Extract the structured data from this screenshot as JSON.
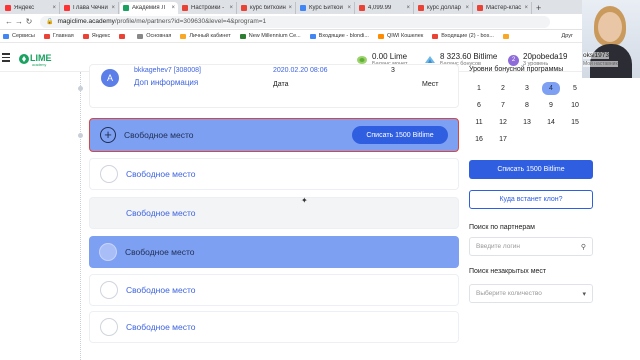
{
  "browser": {
    "tabs": [
      {
        "label": "Яндекс",
        "color": "#f33"
      },
      {
        "label": "Глава Чечни -",
        "color": "#f33"
      },
      {
        "label": "Академия Л",
        "color": "#1aa260",
        "active": true
      },
      {
        "label": "Настройки -",
        "color": "#e94235"
      },
      {
        "label": "курс биткоин",
        "color": "#ea4335"
      },
      {
        "label": "Курс Биткои",
        "color": "#4285f4"
      },
      {
        "label": "4,099.99",
        "color": "#ea4335"
      },
      {
        "label": "курс доллар",
        "color": "#ea4335"
      },
      {
        "label": "Мастер-клас",
        "color": "#ea4335"
      }
    ],
    "new_tab": "+",
    "url_host": "magiclime.academy",
    "url_path": "/profile/me/partners?id=309630&level=4&program=1",
    "nav": {
      "back": "←",
      "forward": "→",
      "reload": "↻"
    }
  },
  "bookmarks": [
    {
      "label": "Сервисы",
      "color": "#4285f4"
    },
    {
      "label": "Главная",
      "color": "#ea4335"
    },
    {
      "label": "Яндекс",
      "color": "#ea4335"
    },
    {
      "label": "",
      "color": "#ea4335"
    },
    {
      "label": "Основная",
      "color": "#888"
    },
    {
      "label": "Личный кабинет",
      "color": "#f9a825"
    },
    {
      "label": "New Millennium Ce...",
      "color": "#2e7d32"
    },
    {
      "label": "Входящие - blondi...",
      "color": "#4285f4"
    },
    {
      "label": "QIWI Кошелек",
      "color": "#ff8c00"
    },
    {
      "label": "Входящие (2) - bos...",
      "color": "#ea4335"
    },
    {
      "label": "",
      "color": "#f9a825"
    }
  ],
  "bookmarks_other": "Друг",
  "header": {
    "logo_text": "LIME",
    "logo_sub": "academy",
    "lime_value": "0.00 Lime",
    "lime_label": "Баланс монет",
    "bitlime_value": "8 323.60 Bitlime",
    "bitlime_label": "Баланс бонусов",
    "user_name": "20pobeda19",
    "user_level": "3 уровень",
    "user_avatar": "2"
  },
  "top_card": {
    "avatar_letter": "A",
    "name_cut": "bkkagehev7 [308008]",
    "date_cut": "2020.02.20 08:06",
    "num_cut": "3",
    "more_link": "Доп информация",
    "date_label": "Дата",
    "places_label": "Мест"
  },
  "slots": [
    {
      "title": "Свободное место",
      "button": "Списать 1500 Bitlime"
    },
    {
      "title": "Свободное место"
    },
    {
      "title": "Свободное место"
    },
    {
      "title": "Свободное место"
    },
    {
      "title": "Свободное место"
    },
    {
      "title": "Свободное место"
    }
  ],
  "right_panel": {
    "levels_title": "Уровни бонусной программы",
    "levels": [
      "1",
      "2",
      "3",
      "4",
      "5",
      "6",
      "7",
      "8",
      "9",
      "10",
      "11",
      "12",
      "13",
      "14",
      "15",
      "16",
      "17"
    ],
    "active_level": "4",
    "spend_button": "Списать 1500 Bitlime",
    "clone_button": "Куда встанет клон?",
    "partner_search_label": "Поиск по партнерам",
    "partner_search_placeholder": "Введите логин",
    "open_places_label": "Поиск незакрытых мест",
    "open_places_placeholder": "Выберите количество"
  },
  "webcam": {
    "user_id": "oksi1973",
    "user_level": "Мой наставник"
  }
}
